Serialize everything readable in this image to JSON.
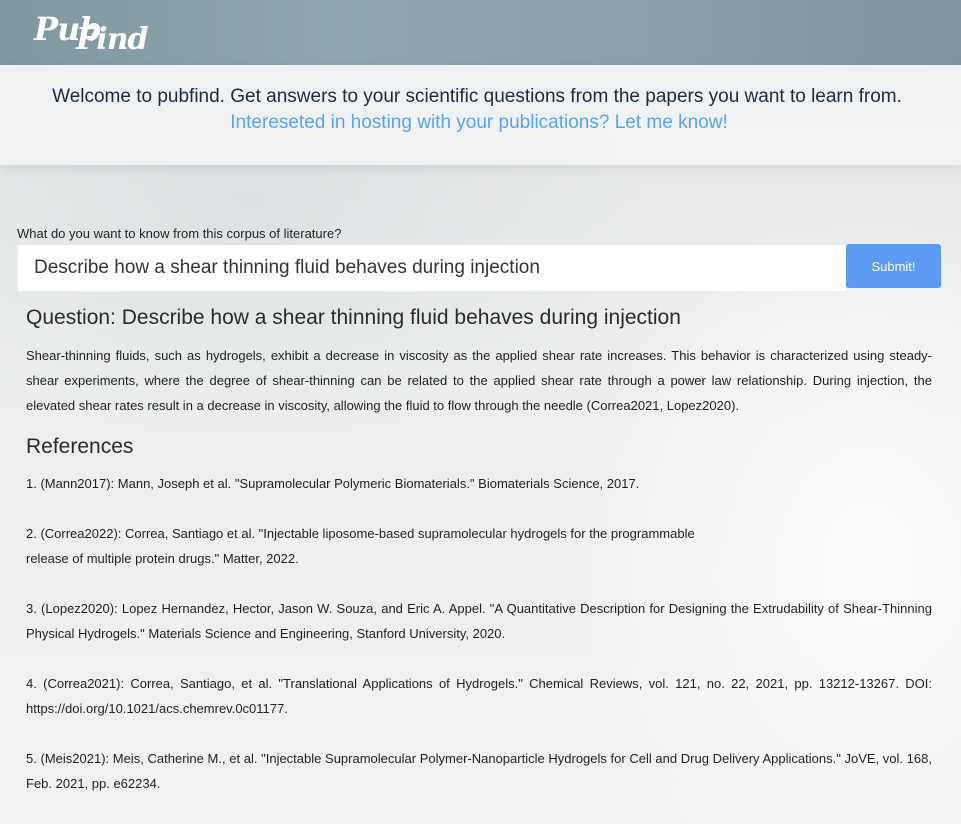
{
  "header": {
    "logo_text_1": "Pub",
    "logo_text_2": "Find"
  },
  "welcome": {
    "line1": "Welcome to pubfind. Get answers to your scientific questions from the papers you want to learn from.",
    "line2": "Intereseted in hosting with your publications? Let me know!"
  },
  "search": {
    "label": "What do you want to know from this corpus of literature?",
    "value": "Describe how a shear thinning fluid behaves during injection",
    "submit_label": "Submit!"
  },
  "result": {
    "question": "Question: Describe how a shear thinning fluid behaves during injection",
    "answer": "Shear-thinning fluids, such as hydrogels, exhibit a decrease in viscosity as the applied shear rate increases. This behavior is characterized using steady-shear experiments, where the degree of shear-thinning can be related to the applied shear rate through a power law relationship. During injection, the elevated shear rates result in a decrease in viscosity, allowing the fluid to flow through the needle (Correa2021, Lopez2020)."
  },
  "references": {
    "title": "References",
    "items": [
      "1. (Mann2017): Mann, Joseph et al. \"Supramolecular Polymeric Biomaterials.\" Biomaterials Science, 2017.",
      "2. (Correa2022): Correa, Santiago et al. \"Injectable liposome-based supramolecular hydrogels for the programmable release of multiple protein drugs.\" Matter, 2022.",
      "3. (Lopez2020): Lopez Hernandez, Hector, Jason W. Souza, and Eric A. Appel. \"A Quantitative Description for Designing the Extrudability of Shear-Thinning Physical Hydrogels.\" Materials Science and Engineering, Stanford University, 2020.",
      "4. (Correa2021): Correa, Santiago, et al. \"Translational Applications of Hydrogels.\" Chemical Reviews, vol. 121, no. 22, 2021, pp. 13212-13267. DOI: https://doi.org/10.1021/acs.chemrev.0c01177.",
      "5. (Meis2021): Meis, Catherine M., et al. \"Injectable Supramolecular Polymer-Nanoparticle Hydrogels for Cell and Drug Delivery Applications.\" JoVE, vol. 168, Feb. 2021, pp. e62234."
    ]
  },
  "colors": {
    "topbar": "#8aa0a9",
    "link": "#5aa3ea",
    "submit": "#5b9bf3"
  }
}
